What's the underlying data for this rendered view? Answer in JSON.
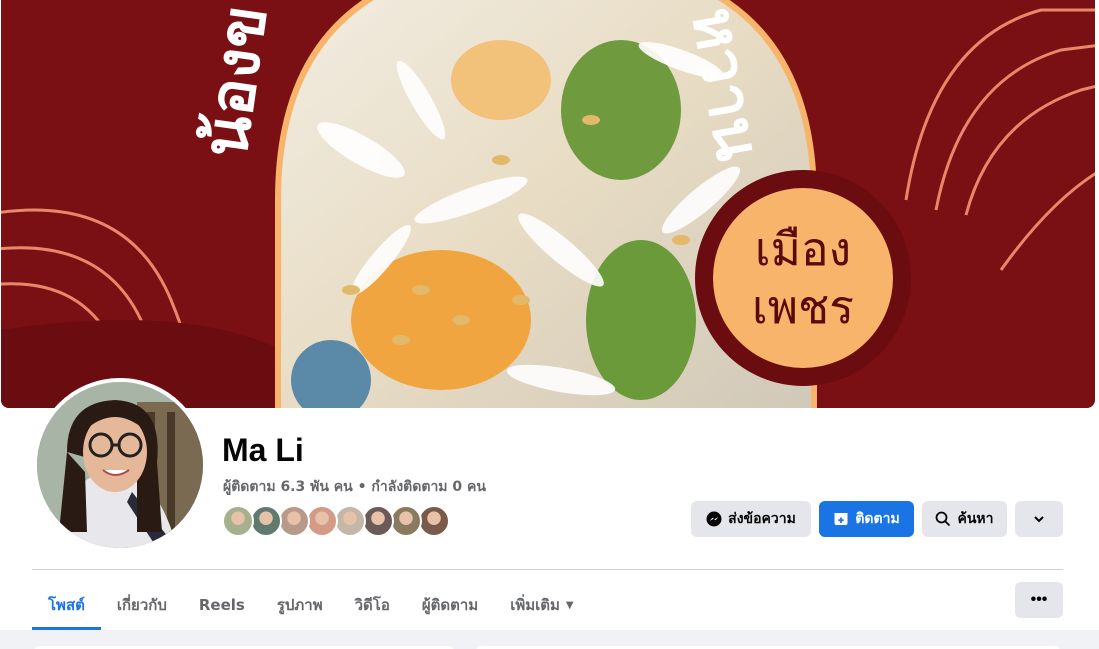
{
  "cover": {
    "title_left": "น้องข",
    "title_right": "หวาน",
    "badge_line1": "เมือง",
    "badge_line2": "เพชร",
    "colors": {
      "background": "#7a1014",
      "badge": "#f7b46a",
      "lines": "#e9876a"
    }
  },
  "profile": {
    "name": "Ma Li",
    "stats": "ผู้ติดตาม 6.3 พัน คน • กำลังติดตาม 0 คน",
    "follower_face_colors": [
      "#a7b08c",
      "#5f7a6e",
      "#b79a8a",
      "#d49a86",
      "#c4b6a8",
      "#6b5a58",
      "#8a7a60",
      "#7a5a4a"
    ]
  },
  "actions": {
    "message_label": "ส่งข้อความ",
    "follow_label": "ติดตาม",
    "search_label": "ค้นหา",
    "more_icon": "chevron-down-icon"
  },
  "tabs": [
    {
      "label": "โพสต์",
      "active": true
    },
    {
      "label": "เกี่ยวกับ",
      "active": false
    },
    {
      "label": "Reels",
      "active": false
    },
    {
      "label": "รูปภาพ",
      "active": false
    },
    {
      "label": "วิดีโอ",
      "active": false
    },
    {
      "label": "ผู้ติดตาม",
      "active": false
    },
    {
      "label": "เพิ่มเติม",
      "active": false
    }
  ],
  "tab_more_icon": "ellipsis-icon",
  "accent_color": "#1b74e4"
}
